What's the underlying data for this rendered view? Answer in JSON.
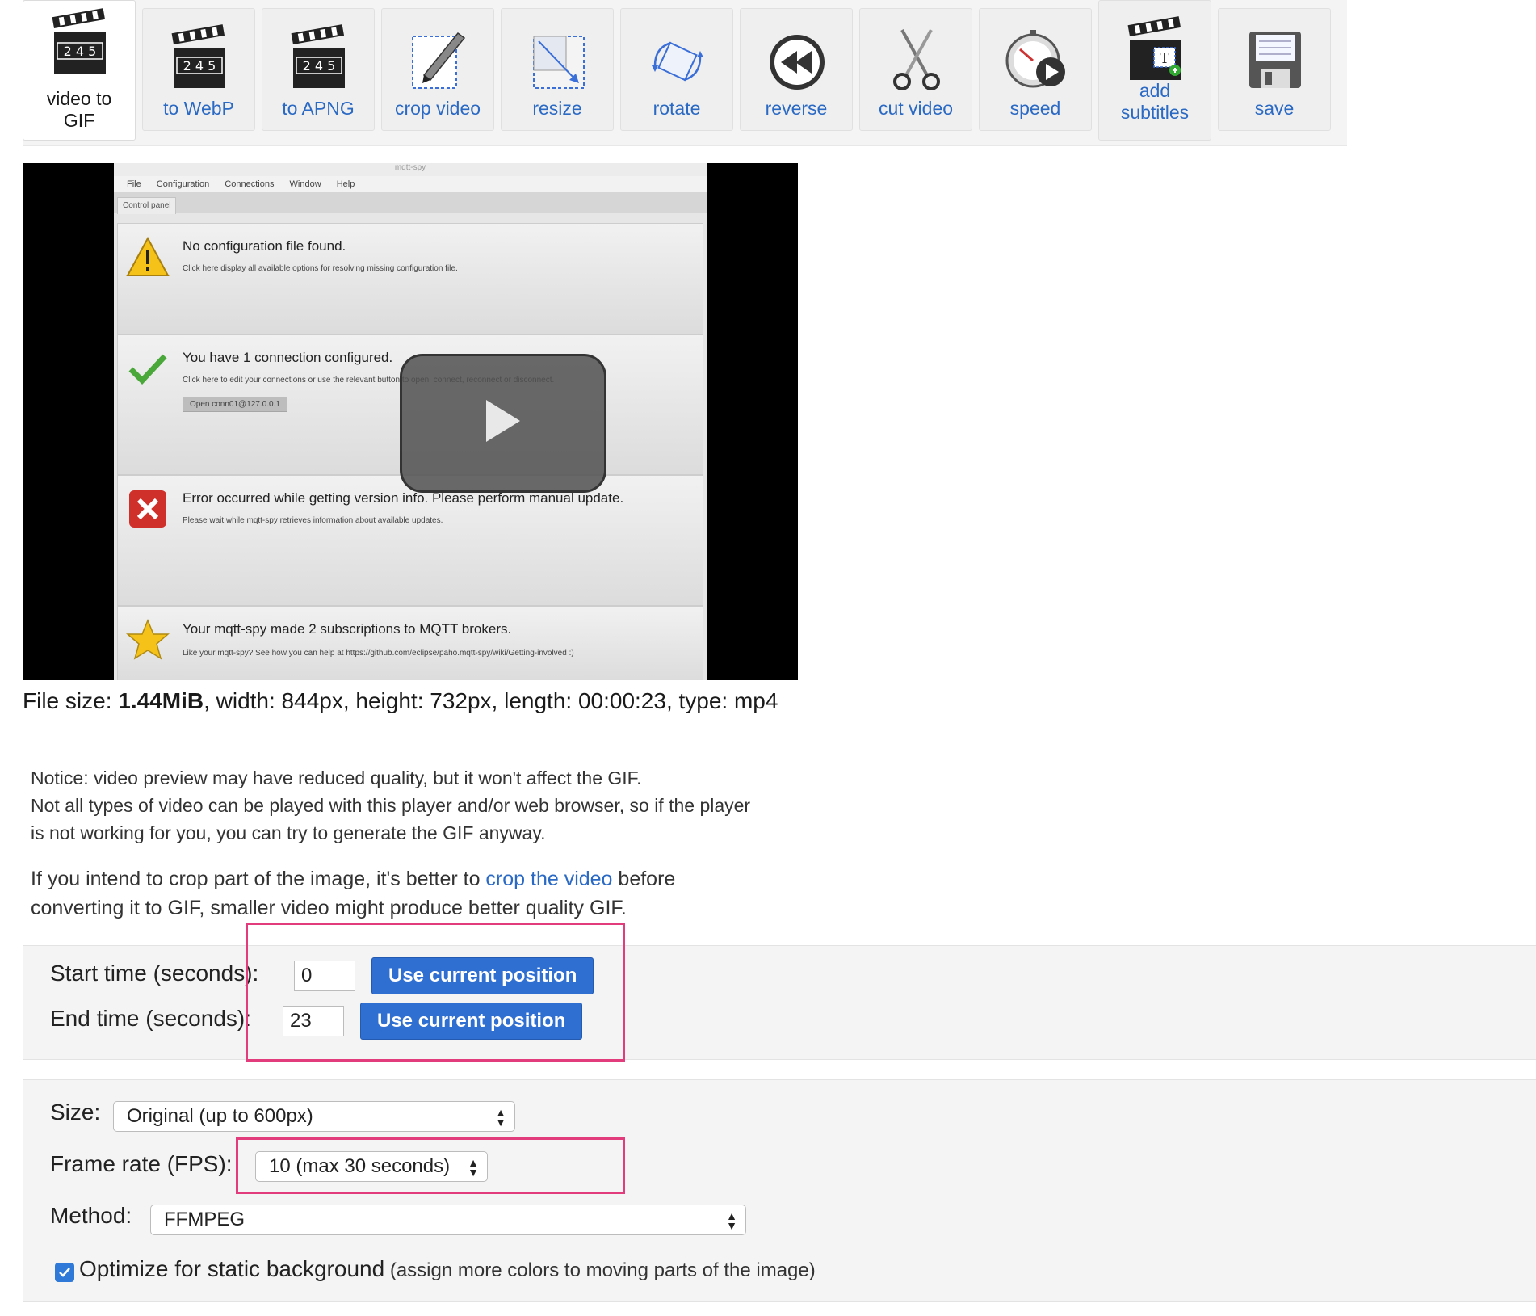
{
  "toolbar": {
    "tools": [
      {
        "label": "video to GIF",
        "icon": "clapperboard-icon"
      },
      {
        "label": "to WebP",
        "icon": "clapperboard-icon"
      },
      {
        "label": "to APNG",
        "icon": "clapperboard-icon"
      },
      {
        "label": "crop video",
        "icon": "crop-icon"
      },
      {
        "label": "resize",
        "icon": "resize-icon"
      },
      {
        "label": "rotate",
        "icon": "rotate-icon"
      },
      {
        "label": "reverse",
        "icon": "reverse-icon"
      },
      {
        "label": "cut video",
        "icon": "scissors-icon"
      },
      {
        "label": "speed",
        "icon": "speed-icon"
      },
      {
        "label": "add subtitles",
        "icon": "subtitles-icon"
      },
      {
        "label": "save",
        "icon": "floppy-disk-icon"
      }
    ],
    "clapper_digits": "2 4 5",
    "active_index": 0
  },
  "video": {
    "window_title": "mqtt-spy",
    "menu": [
      "File",
      "Configuration",
      "Connections",
      "Window",
      "Help"
    ],
    "tab": "Control panel",
    "panels": [
      {
        "title": "No configuration file found.",
        "sub": "Click here display all available options for resolving missing configuration file.",
        "icon": "warning-icon"
      },
      {
        "title": "You have 1 connection configured.",
        "sub": "Click here to edit your connections or use the relevant button to open, connect, reconnect or disconnect.",
        "button": "Open conn01@127.0.0.1",
        "icon": "checkmark-icon"
      },
      {
        "title": "Error occurred while getting version info. Please perform manual update.",
        "sub": "Please wait while mqtt-spy retrieves information about available updates.",
        "icon": "error-icon"
      },
      {
        "title": "Your mqtt-spy made 2 subscriptions to MQTT brokers.",
        "sub": "Like your mqtt-spy? See how you can help at https://github.com/eclipse/paho.mqtt-spy/wiki/Getting-involved :)",
        "icon": "star-icon"
      }
    ]
  },
  "fileinfo": {
    "size_label": "File size: ",
    "size_value": "1.44MiB",
    "rest": ", width: 844px, height: 732px, length: 00:00:23, type: mp4"
  },
  "notice": {
    "line1": "Notice: video preview may have reduced quality, but it won't affect the GIF.",
    "line2": "Not all types of video can be played with this player and/or web browser, so if the player",
    "line3": "is not working for you, you can try to generate the GIF anyway.",
    "crop_pre": "If you intend to crop part of the image, it's better to ",
    "crop_link": "crop the video",
    "crop_post": " before",
    "crop_line2": "converting it to GIF, smaller video might produce better quality GIF."
  },
  "time": {
    "start_label": "Start time (seconds):",
    "start_value": "0",
    "end_label": "End time (seconds):",
    "end_value": "23",
    "button_label": "Use current position"
  },
  "options": {
    "size_label": "Size:",
    "size_value": "Original (up to 600px)",
    "fps_label": "Frame rate (FPS):",
    "fps_value": "10 (max 30 seconds)",
    "method_label": "Method:",
    "method_value": "FFMPEG",
    "optimize_label": "Optimize for static background",
    "optimize_hint": " (assign more colors to moving parts of the image)",
    "optimize_checked": true
  },
  "colors": {
    "link": "#2a69c4",
    "button": "#2f6fd2",
    "highlight": "#e23c7c"
  }
}
